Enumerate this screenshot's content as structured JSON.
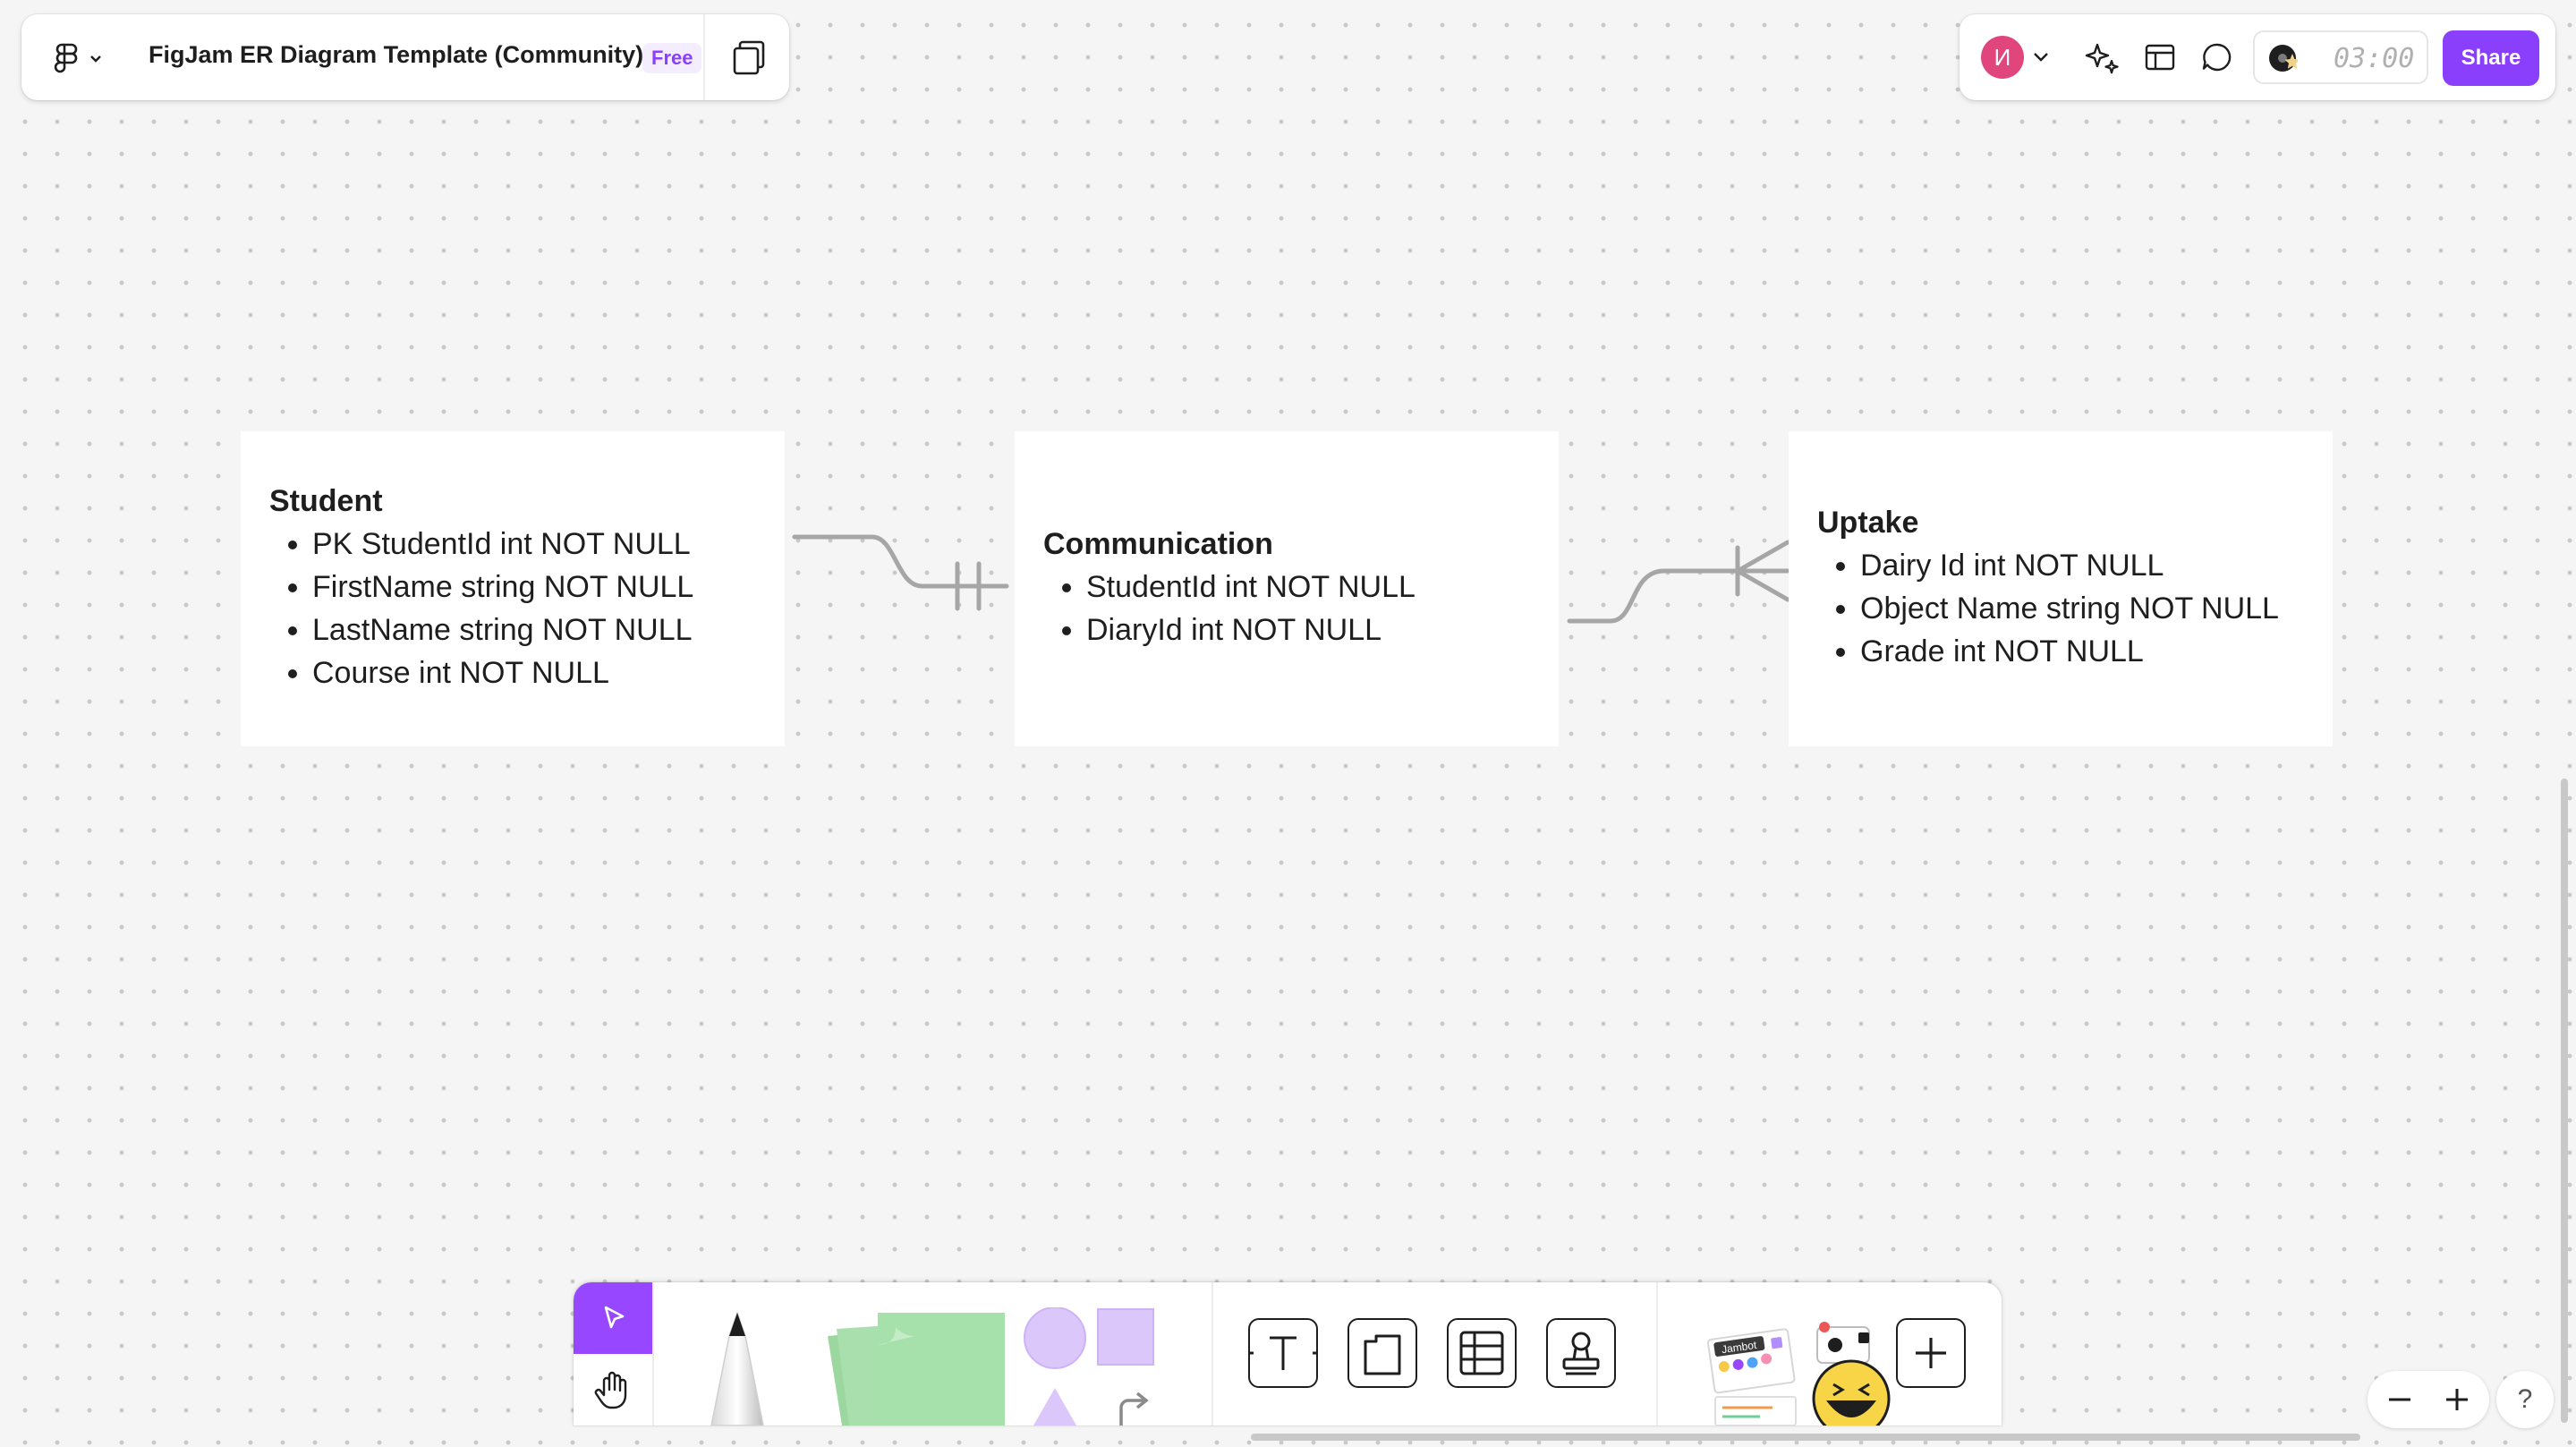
{
  "header": {
    "app_icon": "figma-logo-icon",
    "doc_title": "FigJam ER Diagram Template (Community)",
    "plan_badge": "Free",
    "pages_icon": "pages-icon"
  },
  "top_right": {
    "avatar_initial": "И",
    "avatar_color": "#e0457b",
    "timer": "03:00",
    "share_label": "Share",
    "accent": "#8a3ffc",
    "icons": [
      "ai-sparkle-icon",
      "layout-icon",
      "comment-icon",
      "music-timer-icon"
    ]
  },
  "entities": [
    {
      "title": "Student",
      "fields": [
        "PK StudentId int NOT NULL",
        "FirstName string NOT NULL",
        "LastName string NOT NULL",
        "Course int NOT NULL"
      ]
    },
    {
      "title": "Communication",
      "fields": [
        "StudentId int NOT NULL",
        "DiaryId int NOT NULL"
      ]
    },
    {
      "title": "Uptake",
      "fields": [
        "Dairy Id int NOT NULL",
        "Object Name string NOT NULL",
        "Grade int NOT NULL"
      ]
    }
  ],
  "toolbar": {
    "tools": [
      "select",
      "hand",
      "pen",
      "sticky-note",
      "shapes",
      "text",
      "section",
      "table",
      "stamp",
      "stickers",
      "more"
    ],
    "stickers_label": "Jambot",
    "select_color": "#9747ff"
  },
  "zoom": {
    "out": "−",
    "in": "+",
    "help": "?"
  }
}
